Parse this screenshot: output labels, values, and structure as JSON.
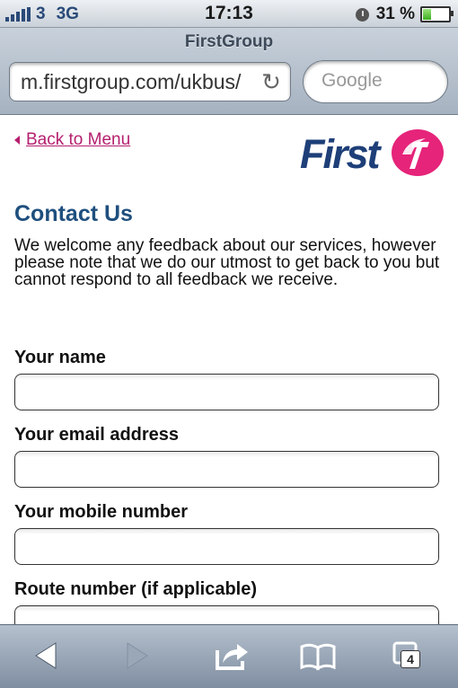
{
  "status_bar": {
    "carrier": "3",
    "network": "3G",
    "time": "17:13",
    "battery_percent": "31 %",
    "battery_level": 0.31
  },
  "browser": {
    "page_title": "FirstGroup",
    "url": "m.firstgroup.com/ukbus/",
    "search_placeholder": "Google",
    "tab_count": "4"
  },
  "page": {
    "back_link": "Back to Menu",
    "logo_text": "First",
    "heading": "Contact Us",
    "intro": "We welcome any feedback about our services, however please note that we do our utmost to get back to you but cannot respond to all feedback we receive.",
    "fields": [
      {
        "label": "Your name"
      },
      {
        "label": "Your email address"
      },
      {
        "label": "Your mobile number"
      },
      {
        "label": "Route number (if applicable)"
      }
    ]
  },
  "colors": {
    "link": "#b5206f",
    "heading": "#1e4f7e",
    "brand_blue": "#1e3f78",
    "brand_pink": "#e5247a"
  },
  "icons": {
    "toolbar": [
      "back-arrow-icon",
      "forward-arrow-icon",
      "share-icon",
      "bookmarks-icon",
      "tabs-icon"
    ]
  }
}
